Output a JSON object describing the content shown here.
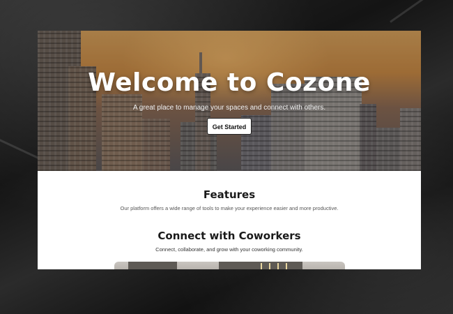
{
  "hero": {
    "title": "Welcome to Cozone",
    "subtitle": "A great place to manage your spaces and connect with others.",
    "cta_label": "Get Started"
  },
  "features": {
    "title": "Features",
    "description": "Our platform offers a wide range of tools to make your experience easier and more productive."
  },
  "connect": {
    "title": "Connect with Coworkers",
    "description": "Connect, collaborate, and grow with your coworking community."
  },
  "colors": {
    "hero_sky": "#c98a45",
    "page_background": "#ffffff",
    "heading_text": "#1a1a1a",
    "backdrop": "#1c1c1c"
  }
}
